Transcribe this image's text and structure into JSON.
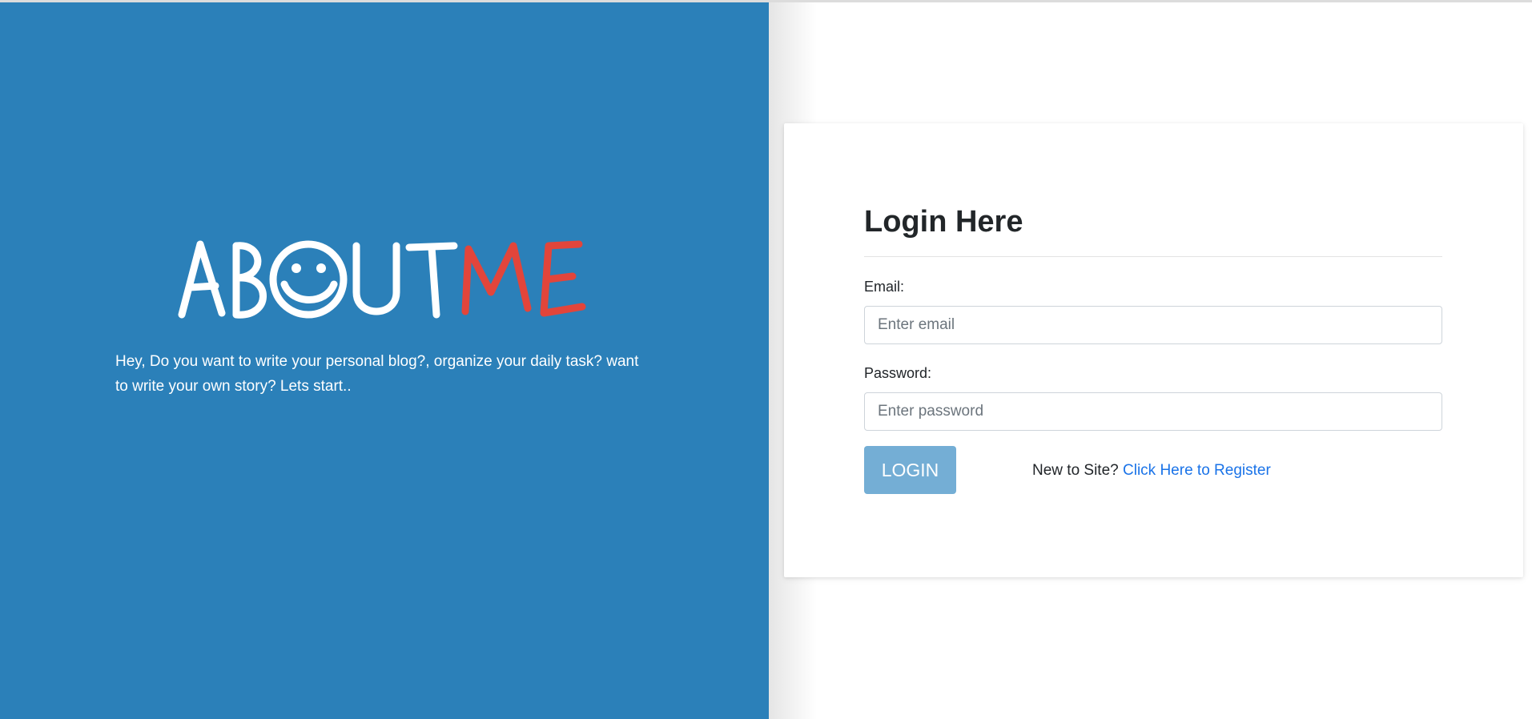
{
  "brand": {
    "logo_text": "ABOUTME",
    "logo_primary": "ABOUT",
    "logo_accent": "ME",
    "logo_color": "#ffffff",
    "accent_color": "#e2453b",
    "panel_color": "#2b80b9"
  },
  "tagline": "Hey, Do you want to write your personal blog?, organize your daily task? want to write your own story? Lets start..",
  "login": {
    "title": "Login Here",
    "email_label": "Email:",
    "email_placeholder": "Enter email",
    "email_value": "",
    "password_label": "Password:",
    "password_placeholder": "Enter password",
    "password_value": "",
    "button_label": "LOGIN",
    "button_color": "#74aed5",
    "register_prompt": "New to Site?",
    "register_link": "Click Here to Register",
    "link_color": "#1a73e8"
  }
}
